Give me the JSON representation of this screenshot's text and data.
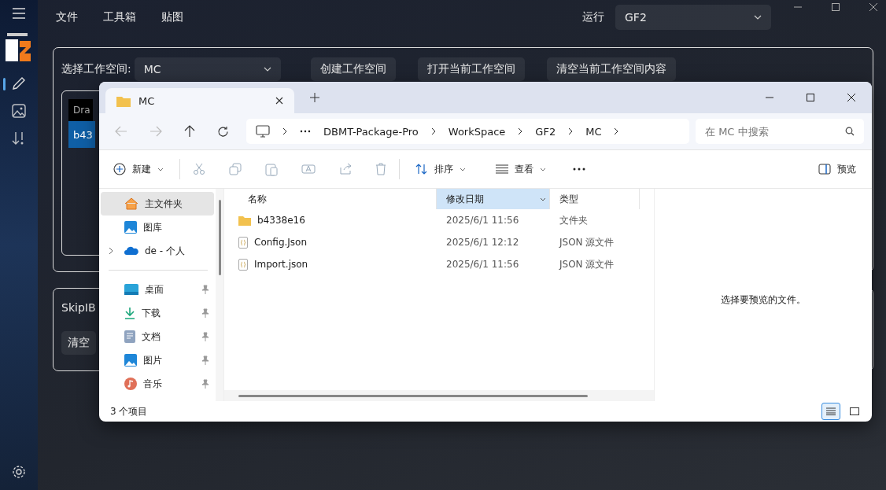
{
  "app": {
    "menu": [
      "文件",
      "工具箱",
      "贴图"
    ],
    "rail": [
      {
        "kind": "pencil",
        "selected": true
      },
      {
        "kind": "image",
        "selected": false
      },
      {
        "kind": "sort",
        "selected": false
      }
    ],
    "run_label": "运行",
    "game_select": {
      "value": "GF2"
    },
    "workspace": {
      "label": "选择工作空间:",
      "select": {
        "value": "MC"
      },
      "buttons": [
        "创建工作空间",
        "打开当前工作空间",
        "清空当前工作空间内容"
      ],
      "list_header": "Dra",
      "list_item": "b43"
    },
    "skipib": {
      "label": "SkipIB",
      "button": "清空"
    }
  },
  "explorer": {
    "tab": "MC",
    "breadcrumb": [
      "DBMT-Package-Pro",
      "WorkSpace",
      "GF2",
      "MC"
    ],
    "search": {
      "placeholder": "在 MC 中搜索"
    },
    "toolbar": {
      "new": "新建",
      "sort": "排序",
      "view": "查看",
      "preview": "预览"
    },
    "nav": [
      {
        "kind": "home",
        "label": "主文件夹",
        "selected": true,
        "expandable": false
      },
      {
        "kind": "gallery",
        "label": "图库",
        "selected": false,
        "expandable": false
      },
      {
        "kind": "cloud",
        "label": "de - 个人",
        "selected": false,
        "expandable": true
      }
    ],
    "quick": [
      {
        "kind": "desktop",
        "label": "桌面",
        "selected": false,
        "pinned": true
      },
      {
        "kind": "download",
        "label": "下载",
        "selected": false,
        "pinned": true
      },
      {
        "kind": "document",
        "label": "文档",
        "selected": false,
        "pinned": true
      },
      {
        "kind": "picture",
        "label": "图片",
        "selected": false,
        "pinned": true
      },
      {
        "kind": "music",
        "label": "音乐",
        "selected": false,
        "pinned": true
      }
    ],
    "columns": [
      {
        "label": "名称",
        "sorted": false
      },
      {
        "label": "修改日期",
        "sorted": true
      },
      {
        "label": "类型",
        "sorted": false
      }
    ],
    "files": [
      {
        "kind": "folder",
        "name": "b4338e16",
        "date": "2025/6/1 11:56",
        "type": "文件夹"
      },
      {
        "kind": "json",
        "name": "Config.Json",
        "date": "2025/6/1 12:12",
        "type": "JSON 源文件"
      },
      {
        "kind": "json",
        "name": "Import.json",
        "date": "2025/6/1 11:56",
        "type": "JSON 源文件"
      }
    ],
    "preview_text": "选择要预览的文件。",
    "status": "3 个项目",
    "views": [
      {
        "kind": "details",
        "selected": true
      },
      {
        "kind": "tiles",
        "selected": false
      }
    ]
  }
}
